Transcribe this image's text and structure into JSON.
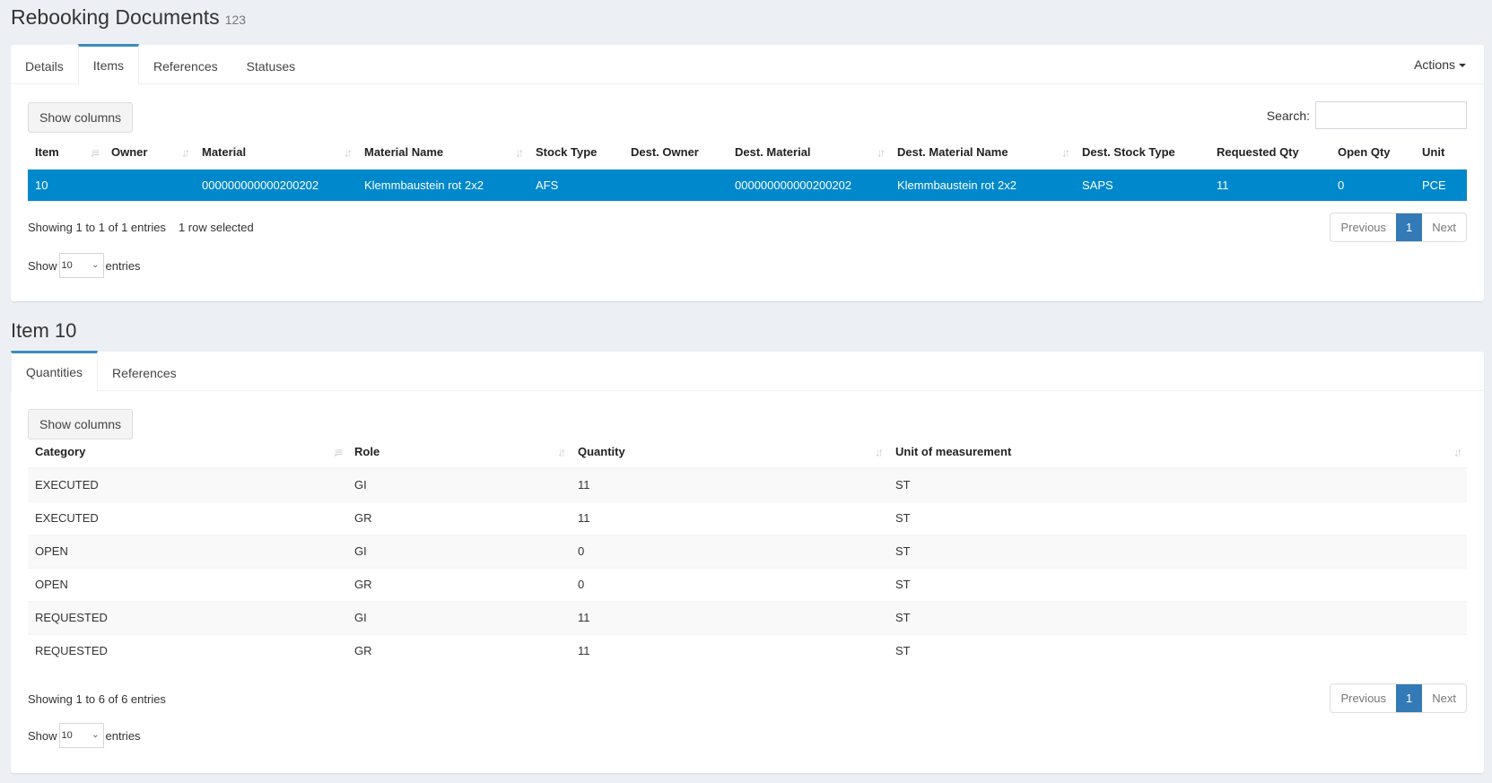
{
  "header": {
    "title": "Rebooking Documents",
    "doc_number": "123"
  },
  "doc_tabs": [
    {
      "label": "Details",
      "active": false
    },
    {
      "label": "Items",
      "active": true
    },
    {
      "label": "References",
      "active": false
    },
    {
      "label": "Statuses",
      "active": false
    }
  ],
  "actions_label": "Actions",
  "items_panel": {
    "show_columns_label": "Show columns",
    "search_label": "Search:",
    "search_value": "",
    "columns": [
      "Item",
      "Owner",
      "Material",
      "Material Name",
      "Stock Type",
      "Dest. Owner",
      "Dest. Material",
      "Dest. Material Name",
      "Dest. Stock Type",
      "Requested Qty",
      "Open Qty",
      "Unit"
    ],
    "rows": [
      {
        "item": "10",
        "owner": "",
        "material": "000000000000200202",
        "material_name": "Klemmbaustein rot 2x2",
        "stock_type": "AFS",
        "dest_owner": "",
        "dest_material": "000000000000200202",
        "dest_material_name": "Klemmbaustein rot 2x2",
        "dest_stock_type": "SAPS",
        "requested_qty": "11",
        "open_qty": "0",
        "unit": "PCE",
        "selected": true
      }
    ],
    "info": "Showing 1 to 1 of 1 entries",
    "selected_info": "1 row selected",
    "length_prefix": "Show",
    "length_value": "10",
    "length_suffix": "entries",
    "pager": {
      "previous": "Previous",
      "current": "1",
      "next": "Next"
    }
  },
  "item_section": {
    "title": "Item 10"
  },
  "item_tabs": [
    {
      "label": "Quantities",
      "active": true
    },
    {
      "label": "References",
      "active": false
    }
  ],
  "qty_panel": {
    "show_columns_label": "Show columns",
    "columns": [
      "Category",
      "Role",
      "Quantity",
      "Unit of measurement"
    ],
    "rows": [
      {
        "category": "EXECUTED",
        "role": "GI",
        "quantity": "11",
        "unit": "ST"
      },
      {
        "category": "EXECUTED",
        "role": "GR",
        "quantity": "11",
        "unit": "ST"
      },
      {
        "category": "OPEN",
        "role": "GI",
        "quantity": "0",
        "unit": "ST"
      },
      {
        "category": "OPEN",
        "role": "GR",
        "quantity": "0",
        "unit": "ST"
      },
      {
        "category": "REQUESTED",
        "role": "GI",
        "quantity": "11",
        "unit": "ST"
      },
      {
        "category": "REQUESTED",
        "role": "GR",
        "quantity": "11",
        "unit": "ST"
      }
    ],
    "info": "Showing 1 to 6 of 6 entries",
    "length_prefix": "Show",
    "length_value": "10",
    "length_suffix": "entries",
    "pager": {
      "previous": "Previous",
      "current": "1",
      "next": "Next"
    }
  },
  "colors": {
    "accent": "#3c8dbc",
    "selected_row": "#0088cc",
    "pager_active": "#337ab7",
    "background": "#ecf0f5"
  }
}
